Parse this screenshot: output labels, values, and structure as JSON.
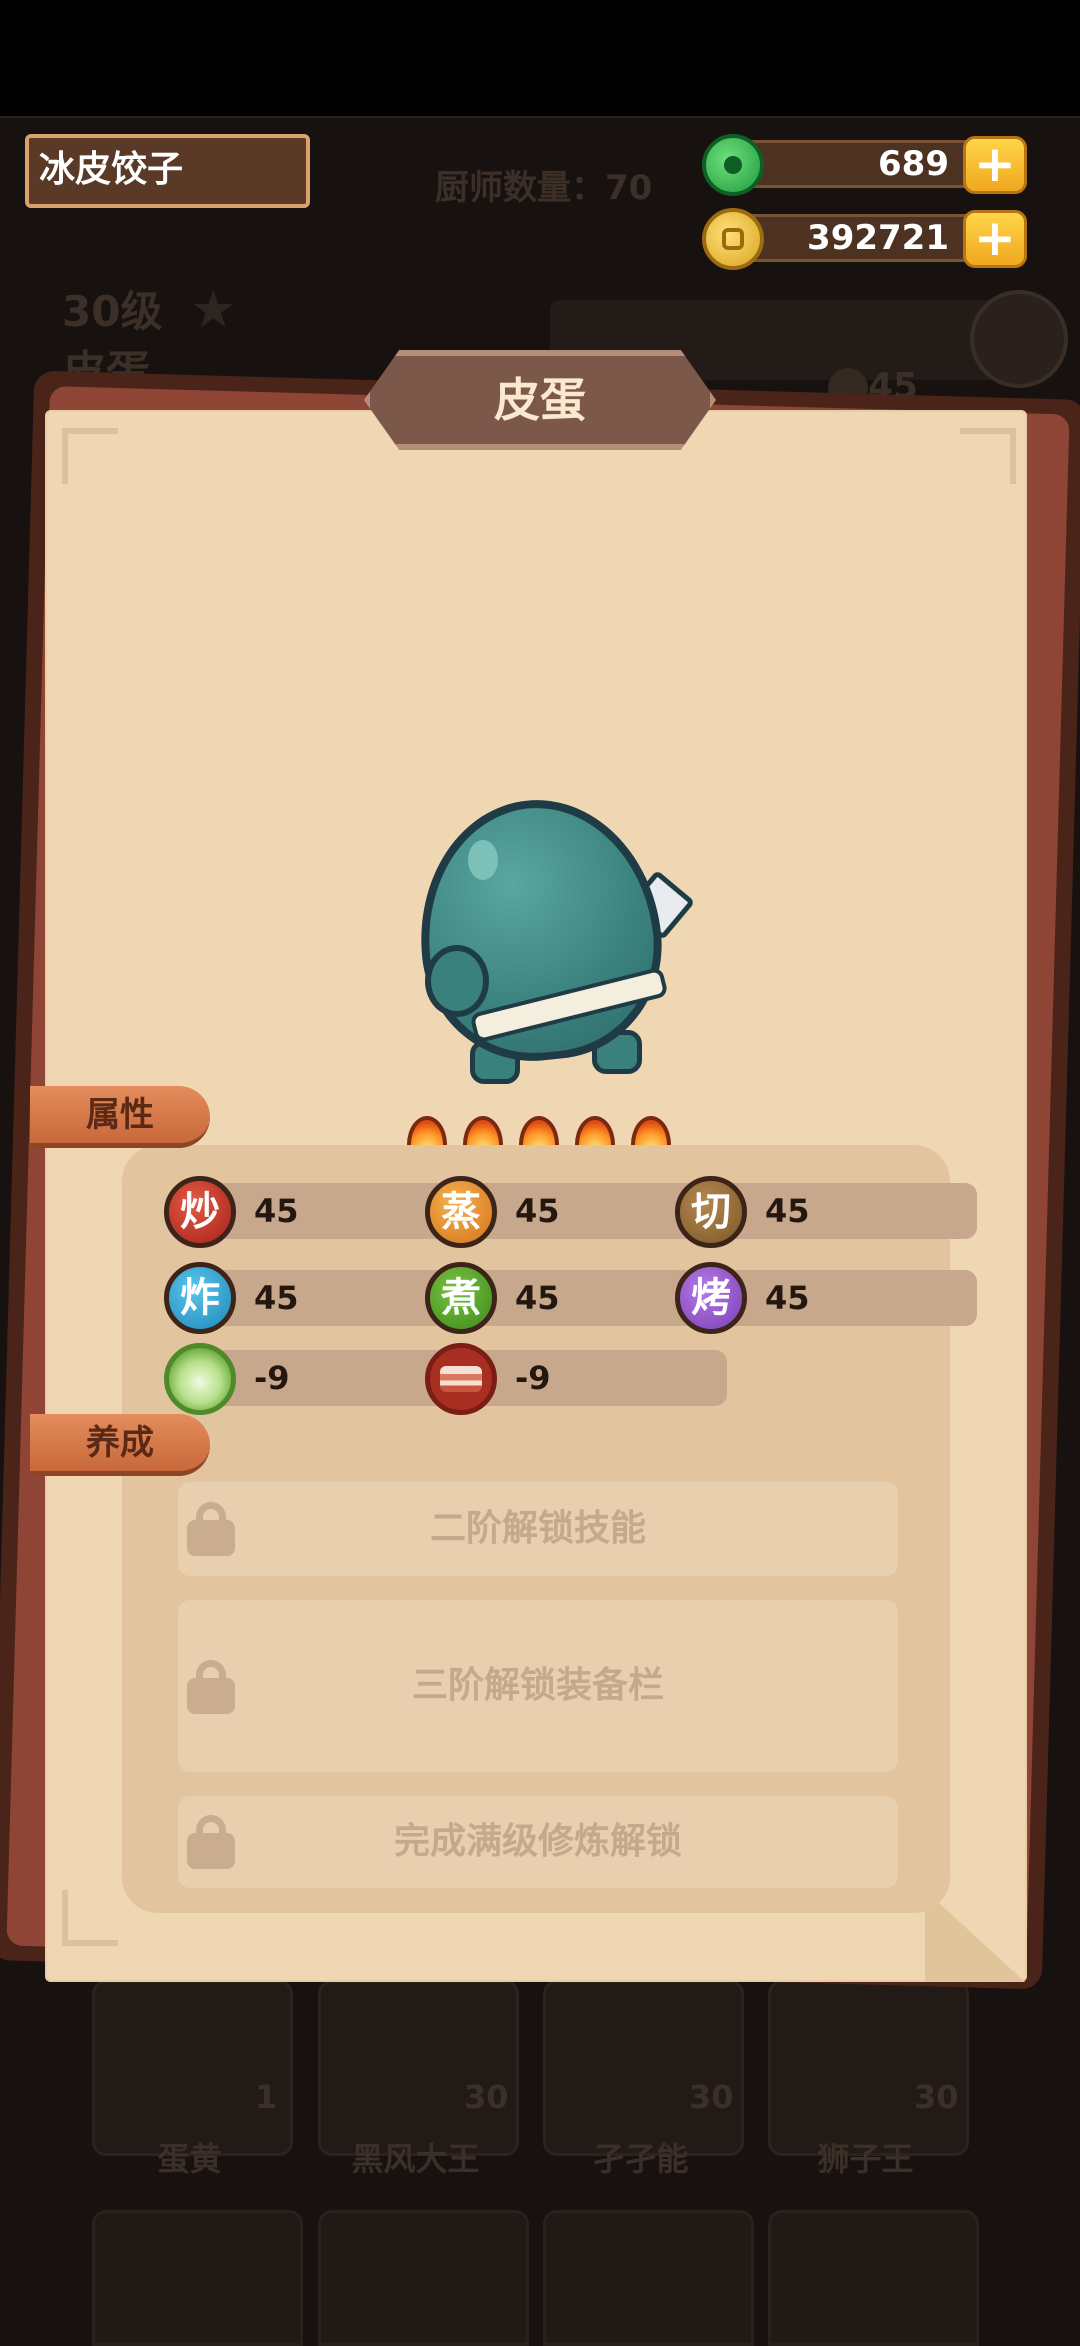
{
  "header": {
    "dish_name": "冰皮饺子",
    "chef_count": "厨师数量：70",
    "jade": "689",
    "coins": "392721",
    "plus_symbol": "+"
  },
  "background": {
    "level": "30级",
    "name": "皮蛋",
    "stat_value": "45",
    "chefs": [
      {
        "name": "蛋黄",
        "level": "1"
      },
      {
        "name": "黑风大王",
        "level": "30"
      },
      {
        "name": "孑孑能",
        "level": "30"
      },
      {
        "name": "狮子王",
        "level": "30"
      }
    ]
  },
  "card": {
    "title": "皮蛋",
    "star_count": 5,
    "tabs": {
      "attributes": "属性",
      "cultivation": "养成"
    },
    "stats": [
      {
        "label": "炒",
        "value": "45",
        "color": "#c43a28"
      },
      {
        "label": "蒸",
        "value": "45",
        "color": "#e48e2c"
      },
      {
        "label": "切",
        "value": "45",
        "color": "#9a7038"
      },
      {
        "label": "炸",
        "value": "45",
        "color": "#2fa4d4"
      },
      {
        "label": "煮",
        "value": "45",
        "color": "#56a42c"
      },
      {
        "label": "烤",
        "value": "45",
        "color": "#9a58d0"
      },
      {
        "icon": "cabbage-icon",
        "value": "-9"
      },
      {
        "icon": "meat-icon",
        "value": "-9"
      }
    ],
    "locked_features": [
      "二阶解锁技能",
      "三阶解锁装备栏",
      "完成满级修炼解锁"
    ]
  }
}
